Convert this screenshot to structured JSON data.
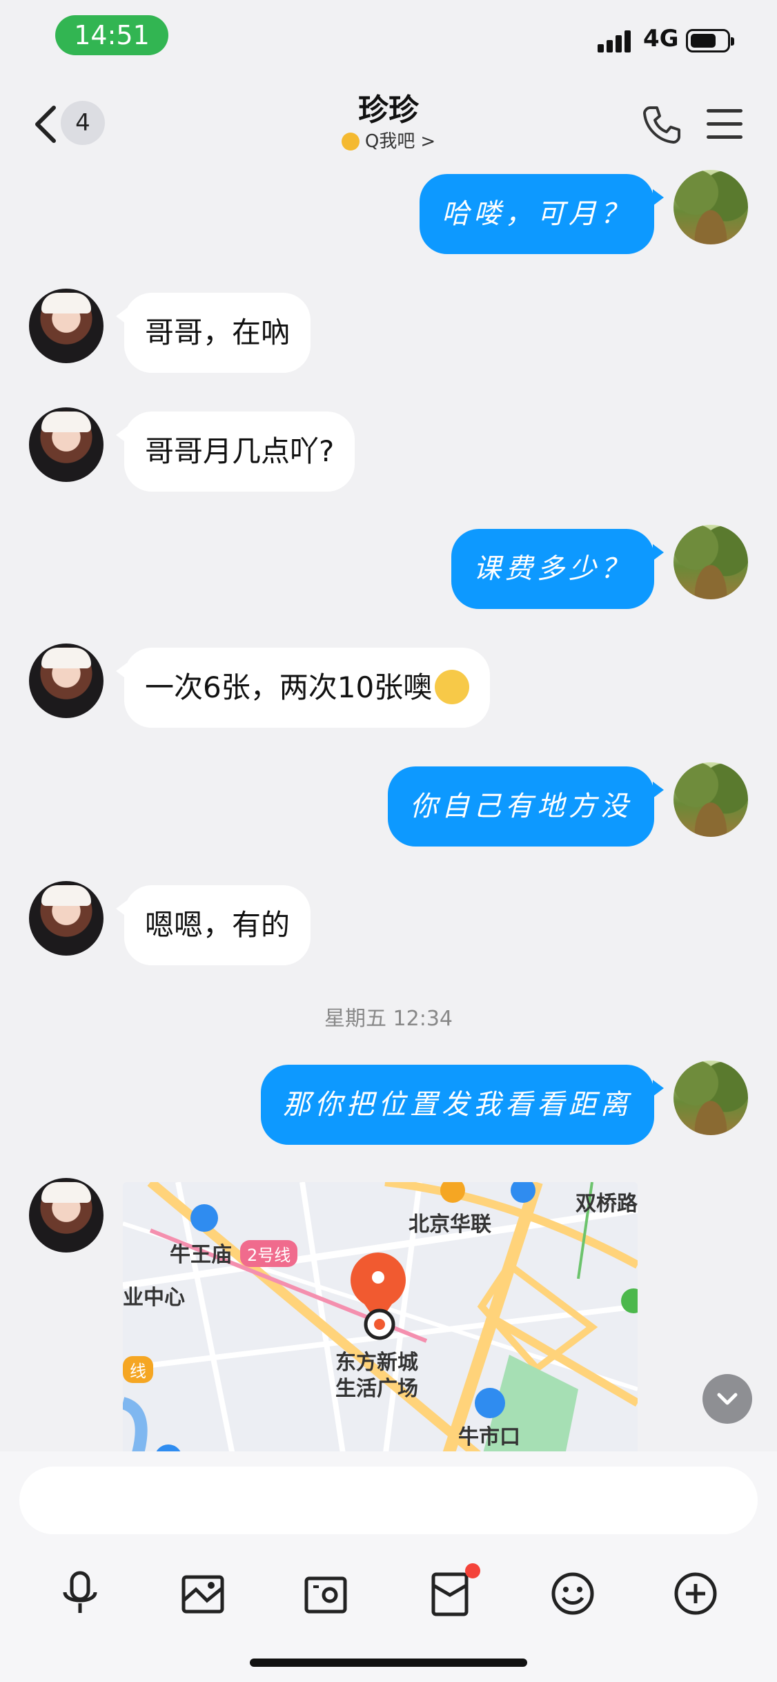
{
  "status_bar": {
    "time": "14:51",
    "network": "4G"
  },
  "nav": {
    "unread_count": "4",
    "title": "珍珍",
    "subtitle": "Q我吧",
    "subtitle_arrow": ">",
    "icons": [
      "back-chevron-icon",
      "phone-icon",
      "menu-icon"
    ]
  },
  "messages": [
    {
      "side": "out",
      "text": "哈喽，可月？"
    },
    {
      "side": "in",
      "text": "哥哥，在吶"
    },
    {
      "side": "in",
      "text": "哥哥月几点吖?"
    },
    {
      "side": "out",
      "text": "课费多少？"
    },
    {
      "side": "in",
      "text": "一次6张，两次10张噢"
    },
    {
      "side": "out",
      "text": "你自己有地方没"
    },
    {
      "side": "in",
      "text": "嗯嗯，有的"
    },
    {
      "side": "out",
      "text": "那你把位置发我看看距离"
    }
  ],
  "timestamp": "星期五 12:34",
  "map": {
    "labels": {
      "bj_hualian": "北京华联",
      "shuangqiao": "双桥路",
      "niuwangmiao": "牛王庙",
      "line2": "2号线",
      "center": "业中心",
      "line_left": "线",
      "dongfang": "东方新城",
      "shenghuo": "生活广场",
      "niushikou": "牛市口"
    }
  },
  "toolbar": {
    "icons": [
      "microphone-icon",
      "image-icon",
      "camera-icon",
      "red-packet-icon",
      "emoji-icon",
      "plus-icon"
    ]
  },
  "colors": {
    "accent": "#0d99ff",
    "status_pill": "#32b552",
    "background": "#f1f1f3"
  }
}
